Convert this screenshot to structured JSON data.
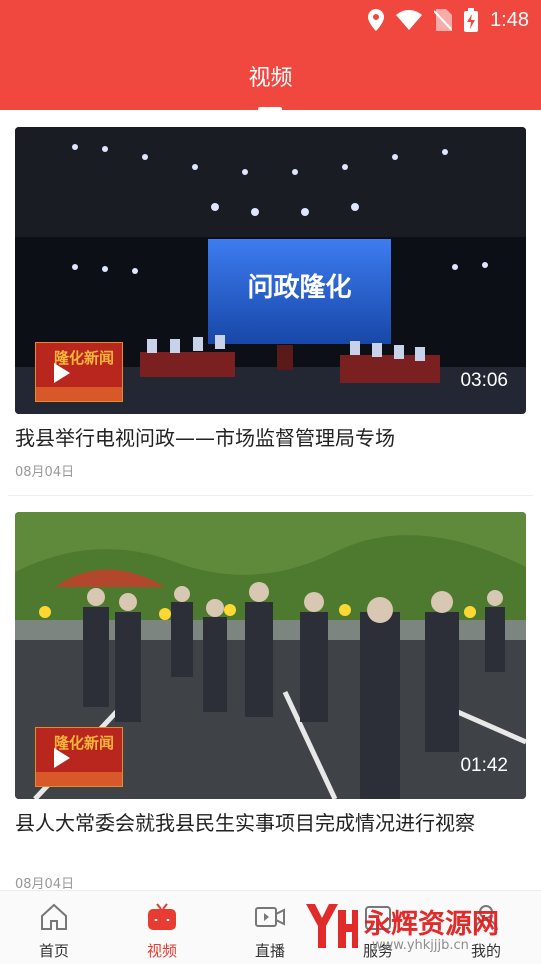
{
  "status": {
    "time": "1:48"
  },
  "header": {
    "title": "视频"
  },
  "videos": [
    {
      "title": "我县举行电视问政——市场监督管理局专场",
      "date": "08月04日",
      "duration": "03:06",
      "screen_text": "问政隆化",
      "logo_text": "隆化新闻"
    },
    {
      "title": "县人大常委会就我县民生实事项目完成情况进行视察",
      "date": "08月04日",
      "duration": "01:42",
      "logo_text": "隆化新闻"
    }
  ],
  "tabs": [
    {
      "label": "首页",
      "icon": "home-icon",
      "active": false
    },
    {
      "label": "视频",
      "icon": "tv-icon",
      "active": true
    },
    {
      "label": "直播",
      "icon": "video-camera-icon",
      "active": false
    },
    {
      "label": "服务",
      "icon": "service-icon",
      "active": false
    },
    {
      "label": "我的",
      "icon": "profile-icon",
      "active": false
    }
  ],
  "watermark": {
    "text": "永辉资源网",
    "url": "www.yhkjjjb.cn"
  },
  "colors": {
    "brand": "#f0473f",
    "active_tab": "#e63c32"
  }
}
